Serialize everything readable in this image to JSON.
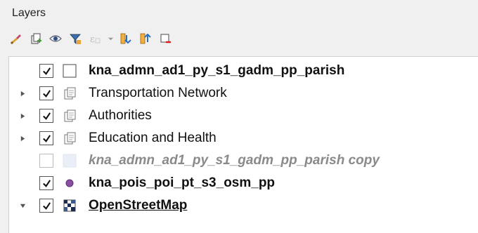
{
  "panel": {
    "title": "Layers"
  },
  "toolbar": {
    "buttons": [
      {
        "icon": "style-manager-icon"
      },
      {
        "icon": "add-group-icon"
      },
      {
        "icon": "manage-visibility-icon"
      },
      {
        "icon": "filter-legend-icon"
      },
      {
        "icon": "filter-by-expression-icon"
      },
      {
        "icon": "expand-all-icon"
      },
      {
        "icon": "collapse-all-icon"
      },
      {
        "icon": "remove-layer-icon"
      }
    ]
  },
  "layers": [
    {
      "label": "kna_admn_ad1_py_s1_gadm_pp_parish",
      "checked": true,
      "expandable": false,
      "icon": "polygon-layer-icon",
      "style": "bold"
    },
    {
      "label": "Transportation Network",
      "checked": true,
      "expandable": true,
      "expanded": false,
      "icon": "group-icon",
      "style": "normal"
    },
    {
      "label": "Authorities",
      "checked": true,
      "expandable": true,
      "expanded": false,
      "icon": "group-icon",
      "style": "normal"
    },
    {
      "label": "Education and Health",
      "checked": true,
      "expandable": true,
      "expanded": false,
      "icon": "group-icon",
      "style": "normal"
    },
    {
      "label": "kna_admn_ad1_py_s1_gadm_pp_parish copy",
      "checked": false,
      "expandable": false,
      "icon": "polygon-layer-faded-icon",
      "style": "italic-gray"
    },
    {
      "label": "kna_pois_poi_pt_s3_osm_pp",
      "checked": true,
      "expandable": false,
      "icon": "point-layer-icon",
      "style": "bold"
    },
    {
      "label": "OpenStreetMap",
      "checked": true,
      "expandable": true,
      "expanded": true,
      "icon": "raster-tile-icon",
      "style": "underline"
    }
  ],
  "colors": {
    "point": "#8a4fa3",
    "tree_bg": "#ffffff",
    "panel_bg": "#f0f0f0"
  }
}
